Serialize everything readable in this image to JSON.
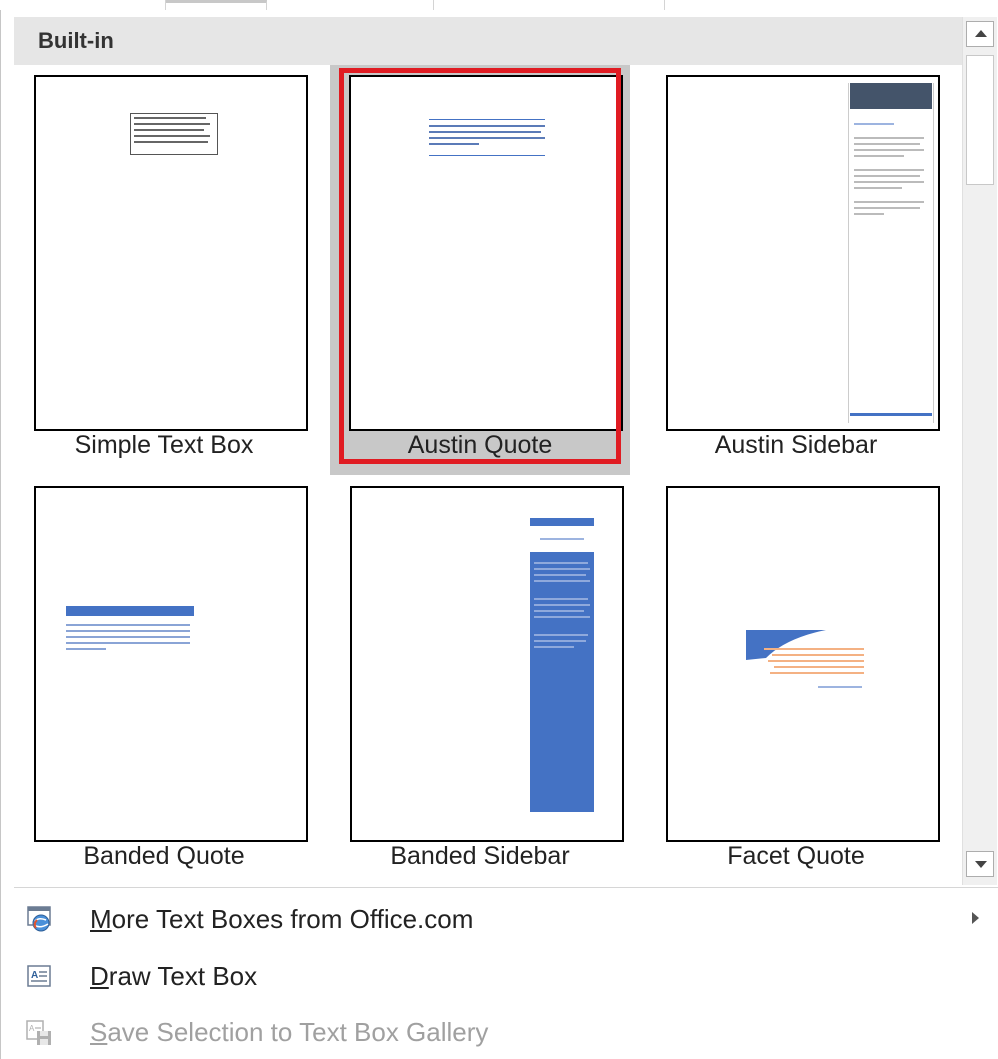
{
  "gallery": {
    "section_title": "Built-in",
    "items": [
      {
        "label": "Simple Text Box",
        "selected": false
      },
      {
        "label": "Austin Quote",
        "selected": true
      },
      {
        "label": "Austin Sidebar",
        "selected": false
      },
      {
        "label": "Banded Quote",
        "selected": false
      },
      {
        "label": "Banded Sidebar",
        "selected": false
      },
      {
        "label": "Facet Quote",
        "selected": false
      }
    ]
  },
  "menu": {
    "more_prefix": "M",
    "more_rest": "ore Text Boxes from Office.com",
    "draw_prefix": "D",
    "draw_rest": "raw Text Box",
    "save_prefix": "S",
    "save_rest": "ave Selection to Text Box Gallery"
  },
  "icons": {
    "more": "office-globe-icon",
    "draw": "text-box-icon",
    "save": "save-to-gallery-icon",
    "submenu": "chevron-right-icon",
    "scroll_up": "scroll-up-arrow-icon",
    "scroll_down": "scroll-down-arrow-icon"
  },
  "colors": {
    "selection_border": "#e01b22",
    "selection_fill": "#c8c8c8",
    "accent_blue": "#4472c4",
    "facet_orange": "#ed7d31",
    "header_bg": "#e6e6e6"
  }
}
